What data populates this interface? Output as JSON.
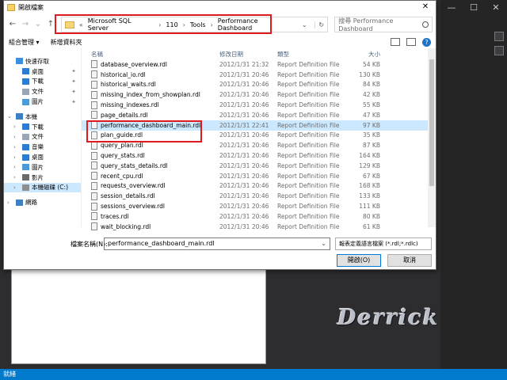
{
  "dialog": {
    "title": "開啟檔案",
    "close": "✕"
  },
  "address": {
    "prefix": "«",
    "segments": [
      "Microsoft SQL Server",
      "110",
      "Tools",
      "Performance Dashboard"
    ],
    "separator": "›"
  },
  "search": {
    "placeholder": "搜尋 Performance Dashboard"
  },
  "toolbar": {
    "organize": "組合管理 ▾",
    "new_folder": "新增資料夾",
    "help": "?"
  },
  "columns": {
    "name": "名稱",
    "modified": "修改日期",
    "type": "類型",
    "size": "大小"
  },
  "nav": [
    {
      "label": "快速存取",
      "caret": "",
      "icon": "star-icon",
      "color": "#3b8fdb",
      "sub": false
    },
    {
      "label": "桌面",
      "caret": "",
      "icon": "desktop-icon",
      "color": "#2c7cd2",
      "sub": true,
      "pin": true
    },
    {
      "label": "下載",
      "caret": "",
      "icon": "download-icon",
      "color": "#2c7cd2",
      "sub": true,
      "pin": true
    },
    {
      "label": "文件",
      "caret": "",
      "icon": "documents-icon",
      "color": "#9aa6b5",
      "sub": true,
      "pin": true
    },
    {
      "label": "圖片",
      "caret": "",
      "icon": "pictures-icon",
      "color": "#4b9bd8",
      "sub": true,
      "pin": true
    },
    {
      "spacer": true
    },
    {
      "label": "本機",
      "caret": "⌄",
      "icon": "this-pc-icon",
      "color": "#3c7fc4",
      "sub": false
    },
    {
      "label": "下載",
      "caret": "›",
      "icon": "download-icon",
      "color": "#2c7cd2",
      "sub": true
    },
    {
      "label": "文件",
      "caret": "›",
      "icon": "documents-icon",
      "color": "#9aa6b5",
      "sub": true
    },
    {
      "label": "音樂",
      "caret": "›",
      "icon": "music-icon",
      "color": "#2c7cd2",
      "sub": true
    },
    {
      "label": "桌面",
      "caret": "›",
      "icon": "desktop-icon",
      "color": "#2c7cd2",
      "sub": true
    },
    {
      "label": "圖片",
      "caret": "›",
      "icon": "pictures-icon",
      "color": "#4b9bd8",
      "sub": true
    },
    {
      "label": "影片",
      "caret": "›",
      "icon": "videos-icon",
      "color": "#6a6a6a",
      "sub": true
    },
    {
      "label": "本機磁碟 (C:)",
      "caret": "›",
      "icon": "drive-icon",
      "color": "#8e8e8e",
      "sub": true,
      "selected": true
    },
    {
      "spacer": true
    },
    {
      "label": "網路",
      "caret": "›",
      "icon": "network-icon",
      "color": "#3c7fc4",
      "sub": false
    }
  ],
  "files": [
    {
      "name": "database_overview.rdl",
      "date": "2012/1/31 21:32",
      "type": "Report Definition File",
      "size": "54 KB"
    },
    {
      "name": "historical_io.rdl",
      "date": "2012/1/31 20:46",
      "type": "Report Definition File",
      "size": "130 KB"
    },
    {
      "name": "historical_waits.rdl",
      "date": "2012/1/31 20:46",
      "type": "Report Definition File",
      "size": "84 KB"
    },
    {
      "name": "missing_index_from_showplan.rdl",
      "date": "2012/1/31 20:46",
      "type": "Report Definition File",
      "size": "42 KB"
    },
    {
      "name": "missing_indexes.rdl",
      "date": "2012/1/31 20:46",
      "type": "Report Definition File",
      "size": "55 KB"
    },
    {
      "name": "page_details.rdl",
      "date": "2012/1/31 20:46",
      "type": "Report Definition File",
      "size": "47 KB"
    },
    {
      "name": "performance_dashboard_main.rdl",
      "date": "2012/1/31 22:41",
      "type": "Report Definition File",
      "size": "97 KB",
      "selected": true
    },
    {
      "name": "plan_guide.rdl",
      "date": "2012/1/31 20:46",
      "type": "Report Definition File",
      "size": "35 KB"
    },
    {
      "name": "query_plan.rdl",
      "date": "2012/1/31 20:46",
      "type": "Report Definition File",
      "size": "87 KB"
    },
    {
      "name": "query_stats.rdl",
      "date": "2012/1/31 20:46",
      "type": "Report Definition File",
      "size": "164 KB"
    },
    {
      "name": "query_stats_details.rdl",
      "date": "2012/1/31 20:46",
      "type": "Report Definition File",
      "size": "129 KB"
    },
    {
      "name": "recent_cpu.rdl",
      "date": "2012/1/31 20:46",
      "type": "Report Definition File",
      "size": "67 KB"
    },
    {
      "name": "requests_overview.rdl",
      "date": "2012/1/31 20:46",
      "type": "Report Definition File",
      "size": "168 KB"
    },
    {
      "name": "session_details.rdl",
      "date": "2012/1/31 20:46",
      "type": "Report Definition File",
      "size": "133 KB"
    },
    {
      "name": "sessions_overview.rdl",
      "date": "2012/1/31 20:46",
      "type": "Report Definition File",
      "size": "111 KB"
    },
    {
      "name": "traces.rdl",
      "date": "2012/1/31 20:46",
      "type": "Report Definition File",
      "size": "80 KB"
    },
    {
      "name": "wait_blocking.rdl",
      "date": "2012/1/31 20:46",
      "type": "Report Definition File",
      "size": "61 KB"
    }
  ],
  "bottom": {
    "filename_label": "檔案名稱(N):",
    "filename_value": "performance_dashboard_main.rdl",
    "filter": "報表定義語言檔案 (*.rdl;*.rdlc)",
    "open": "開啟(O)",
    "cancel": "取消"
  },
  "background": {
    "watermark": "Derrick",
    "status": "就緒"
  }
}
